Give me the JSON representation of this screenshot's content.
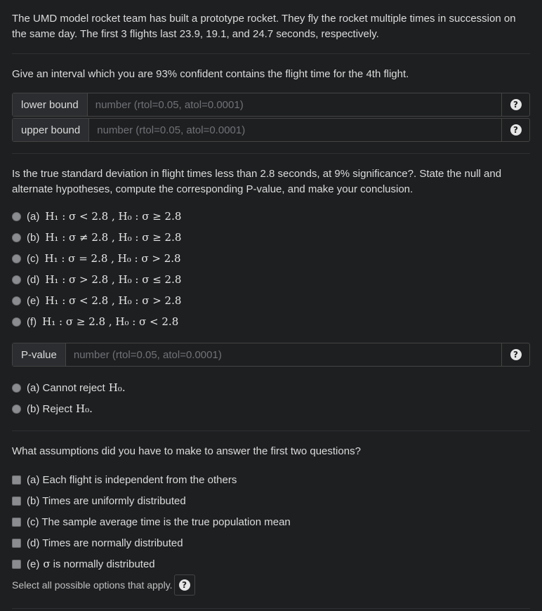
{
  "intro": "The UMD model rocket team has built a prototype rocket. They fly the rocket multiple times in succession on the same day. The first 3 flights last 23.9, 19.1, and 24.7 seconds, respectively.",
  "q1": {
    "text": "Give an interval which you are 93% confident contains the flight time for the 4th flight.",
    "lower_label": "lower bound",
    "upper_label": "upper bound",
    "placeholder": "number (rtol=0.05, atol=0.0001)"
  },
  "q2": {
    "text": "Is the true standard deviation in flight times less than 2.8 seconds, at 9% significance?. State the null and alternate hypotheses, compute the corresponding P-value, and make your conclusion.",
    "options": [
      {
        "label": "(a)",
        "h1": "H₁ : σ < 2.8 , H₀ : σ ≥ 2.8"
      },
      {
        "label": "(b)",
        "h1": "H₁ : σ ≠ 2.8 , H₀ : σ ≥ 2.8"
      },
      {
        "label": "(c)",
        "h1": "H₁ : σ = 2.8 , H₀ : σ > 2.8"
      },
      {
        "label": "(d)",
        "h1": "H₁ : σ > 2.8 , H₀ : σ ≤ 2.8"
      },
      {
        "label": "(e)",
        "h1": "H₁ : σ < 2.8 , H₀ : σ > 2.8"
      },
      {
        "label": "(f)",
        "h1": "H₁ : σ ≥ 2.8 , H₀ : σ < 2.8"
      }
    ],
    "pvalue_label": "P-value",
    "placeholder": "number (rtol=0.05, atol=0.0001)",
    "conclusions": [
      {
        "label": "(a) Cannot reject",
        "math": "H₀."
      },
      {
        "label": "(b) Reject",
        "math": "H₀."
      }
    ]
  },
  "q3": {
    "text": "What assumptions did you have to make to answer the first two questions?",
    "options": [
      "(a) Each flight is independent from the others",
      "(b) Times are uniformly distributed",
      "(c) The sample average time is the true population mean",
      "(d) Times are normally distributed"
    ],
    "last_option_prefix": "(e)",
    "last_option_math": "σ",
    "last_option_suffix": "is normally distributed",
    "note": "Select all possible options that apply."
  }
}
